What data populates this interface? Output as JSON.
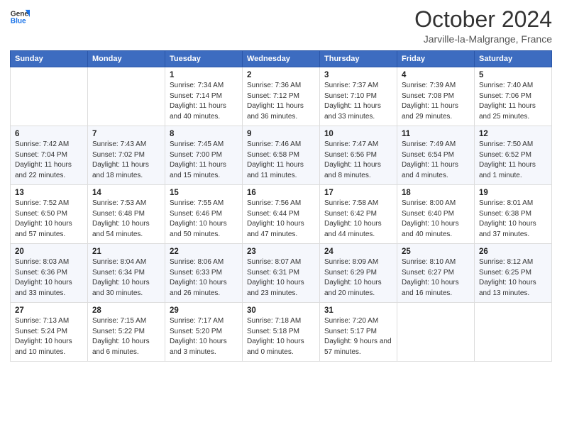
{
  "header": {
    "logo_line1": "General",
    "logo_line2": "Blue",
    "month": "October 2024",
    "location": "Jarville-la-Malgrange, France"
  },
  "columns": [
    "Sunday",
    "Monday",
    "Tuesday",
    "Wednesday",
    "Thursday",
    "Friday",
    "Saturday"
  ],
  "weeks": [
    [
      {
        "day": "",
        "sunrise": "",
        "sunset": "",
        "daylight": ""
      },
      {
        "day": "",
        "sunrise": "",
        "sunset": "",
        "daylight": ""
      },
      {
        "day": "1",
        "sunrise": "Sunrise: 7:34 AM",
        "sunset": "Sunset: 7:14 PM",
        "daylight": "Daylight: 11 hours and 40 minutes."
      },
      {
        "day": "2",
        "sunrise": "Sunrise: 7:36 AM",
        "sunset": "Sunset: 7:12 PM",
        "daylight": "Daylight: 11 hours and 36 minutes."
      },
      {
        "day": "3",
        "sunrise": "Sunrise: 7:37 AM",
        "sunset": "Sunset: 7:10 PM",
        "daylight": "Daylight: 11 hours and 33 minutes."
      },
      {
        "day": "4",
        "sunrise": "Sunrise: 7:39 AM",
        "sunset": "Sunset: 7:08 PM",
        "daylight": "Daylight: 11 hours and 29 minutes."
      },
      {
        "day": "5",
        "sunrise": "Sunrise: 7:40 AM",
        "sunset": "Sunset: 7:06 PM",
        "daylight": "Daylight: 11 hours and 25 minutes."
      }
    ],
    [
      {
        "day": "6",
        "sunrise": "Sunrise: 7:42 AM",
        "sunset": "Sunset: 7:04 PM",
        "daylight": "Daylight: 11 hours and 22 minutes."
      },
      {
        "day": "7",
        "sunrise": "Sunrise: 7:43 AM",
        "sunset": "Sunset: 7:02 PM",
        "daylight": "Daylight: 11 hours and 18 minutes."
      },
      {
        "day": "8",
        "sunrise": "Sunrise: 7:45 AM",
        "sunset": "Sunset: 7:00 PM",
        "daylight": "Daylight: 11 hours and 15 minutes."
      },
      {
        "day": "9",
        "sunrise": "Sunrise: 7:46 AM",
        "sunset": "Sunset: 6:58 PM",
        "daylight": "Daylight: 11 hours and 11 minutes."
      },
      {
        "day": "10",
        "sunrise": "Sunrise: 7:47 AM",
        "sunset": "Sunset: 6:56 PM",
        "daylight": "Daylight: 11 hours and 8 minutes."
      },
      {
        "day": "11",
        "sunrise": "Sunrise: 7:49 AM",
        "sunset": "Sunset: 6:54 PM",
        "daylight": "Daylight: 11 hours and 4 minutes."
      },
      {
        "day": "12",
        "sunrise": "Sunrise: 7:50 AM",
        "sunset": "Sunset: 6:52 PM",
        "daylight": "Daylight: 11 hours and 1 minute."
      }
    ],
    [
      {
        "day": "13",
        "sunrise": "Sunrise: 7:52 AM",
        "sunset": "Sunset: 6:50 PM",
        "daylight": "Daylight: 10 hours and 57 minutes."
      },
      {
        "day": "14",
        "sunrise": "Sunrise: 7:53 AM",
        "sunset": "Sunset: 6:48 PM",
        "daylight": "Daylight: 10 hours and 54 minutes."
      },
      {
        "day": "15",
        "sunrise": "Sunrise: 7:55 AM",
        "sunset": "Sunset: 6:46 PM",
        "daylight": "Daylight: 10 hours and 50 minutes."
      },
      {
        "day": "16",
        "sunrise": "Sunrise: 7:56 AM",
        "sunset": "Sunset: 6:44 PM",
        "daylight": "Daylight: 10 hours and 47 minutes."
      },
      {
        "day": "17",
        "sunrise": "Sunrise: 7:58 AM",
        "sunset": "Sunset: 6:42 PM",
        "daylight": "Daylight: 10 hours and 44 minutes."
      },
      {
        "day": "18",
        "sunrise": "Sunrise: 8:00 AM",
        "sunset": "Sunset: 6:40 PM",
        "daylight": "Daylight: 10 hours and 40 minutes."
      },
      {
        "day": "19",
        "sunrise": "Sunrise: 8:01 AM",
        "sunset": "Sunset: 6:38 PM",
        "daylight": "Daylight: 10 hours and 37 minutes."
      }
    ],
    [
      {
        "day": "20",
        "sunrise": "Sunrise: 8:03 AM",
        "sunset": "Sunset: 6:36 PM",
        "daylight": "Daylight: 10 hours and 33 minutes."
      },
      {
        "day": "21",
        "sunrise": "Sunrise: 8:04 AM",
        "sunset": "Sunset: 6:34 PM",
        "daylight": "Daylight: 10 hours and 30 minutes."
      },
      {
        "day": "22",
        "sunrise": "Sunrise: 8:06 AM",
        "sunset": "Sunset: 6:33 PM",
        "daylight": "Daylight: 10 hours and 26 minutes."
      },
      {
        "day": "23",
        "sunrise": "Sunrise: 8:07 AM",
        "sunset": "Sunset: 6:31 PM",
        "daylight": "Daylight: 10 hours and 23 minutes."
      },
      {
        "day": "24",
        "sunrise": "Sunrise: 8:09 AM",
        "sunset": "Sunset: 6:29 PM",
        "daylight": "Daylight: 10 hours and 20 minutes."
      },
      {
        "day": "25",
        "sunrise": "Sunrise: 8:10 AM",
        "sunset": "Sunset: 6:27 PM",
        "daylight": "Daylight: 10 hours and 16 minutes."
      },
      {
        "day": "26",
        "sunrise": "Sunrise: 8:12 AM",
        "sunset": "Sunset: 6:25 PM",
        "daylight": "Daylight: 10 hours and 13 minutes."
      }
    ],
    [
      {
        "day": "27",
        "sunrise": "Sunrise: 7:13 AM",
        "sunset": "Sunset: 5:24 PM",
        "daylight": "Daylight: 10 hours and 10 minutes."
      },
      {
        "day": "28",
        "sunrise": "Sunrise: 7:15 AM",
        "sunset": "Sunset: 5:22 PM",
        "daylight": "Daylight: 10 hours and 6 minutes."
      },
      {
        "day": "29",
        "sunrise": "Sunrise: 7:17 AM",
        "sunset": "Sunset: 5:20 PM",
        "daylight": "Daylight: 10 hours and 3 minutes."
      },
      {
        "day": "30",
        "sunrise": "Sunrise: 7:18 AM",
        "sunset": "Sunset: 5:18 PM",
        "daylight": "Daylight: 10 hours and 0 minutes."
      },
      {
        "day": "31",
        "sunrise": "Sunrise: 7:20 AM",
        "sunset": "Sunset: 5:17 PM",
        "daylight": "Daylight: 9 hours and 57 minutes."
      },
      {
        "day": "",
        "sunrise": "",
        "sunset": "",
        "daylight": ""
      },
      {
        "day": "",
        "sunrise": "",
        "sunset": "",
        "daylight": ""
      }
    ]
  ]
}
